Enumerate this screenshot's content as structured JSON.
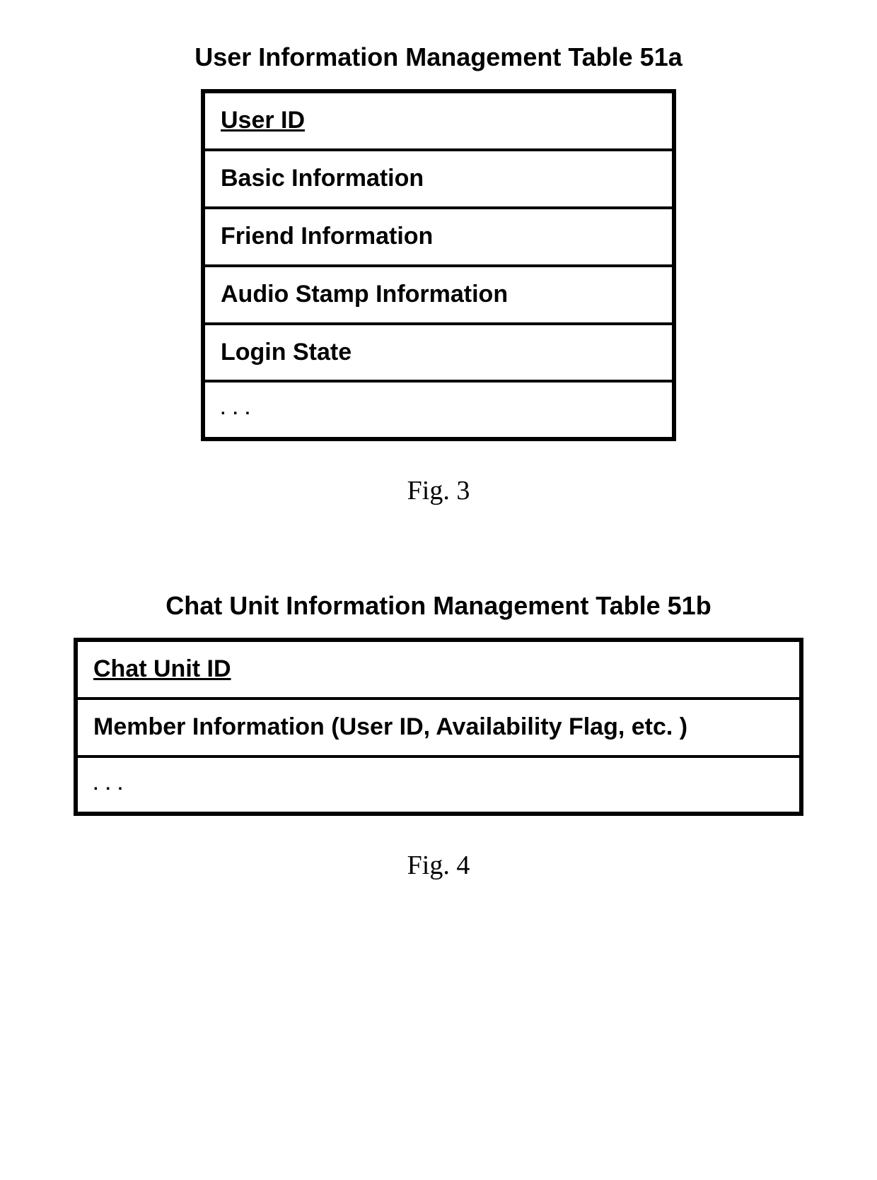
{
  "figures": [
    {
      "title": "User Information Management Table 51a",
      "rows": [
        {
          "label": "User ID",
          "underline": true
        },
        {
          "label": "Basic Information",
          "underline": false
        },
        {
          "label": "Friend Information",
          "underline": false
        },
        {
          "label": "Audio Stamp Information",
          "underline": false
        },
        {
          "label": "Login State",
          "underline": false
        },
        {
          "label": ". . .",
          "underline": false,
          "dots": true
        }
      ],
      "caption": "Fig. 3",
      "width": "narrow"
    },
    {
      "title": "Chat Unit Information Management Table 51b",
      "rows": [
        {
          "label": "Chat Unit ID",
          "underline": true
        },
        {
          "label": "Member Information (User ID, Availability Flag, etc. )",
          "underline": false
        },
        {
          "label": ". . .",
          "underline": false,
          "dots": true
        }
      ],
      "caption": "Fig. 4",
      "width": "wide"
    }
  ]
}
